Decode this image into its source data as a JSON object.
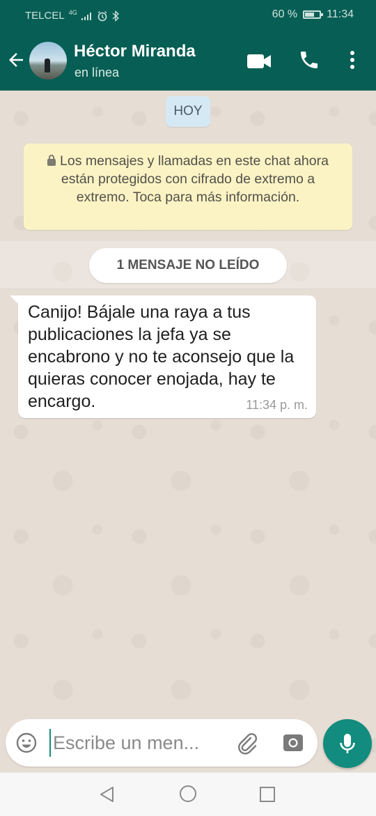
{
  "status_bar": {
    "carrier": "TELCEL",
    "network": "4G",
    "battery_percent": "60 %",
    "battery_level": 0.6,
    "time": "11:34"
  },
  "header": {
    "contact_name": "Héctor Miranda",
    "contact_status": "en línea"
  },
  "chat": {
    "date_chip": "HOY",
    "encryption_notice": "Los mensajes y llamadas en este chat ahora están protegidos con cifrado de extremo a extremo. Toca para más información.",
    "unread_label": "1 MENSAJE NO LEÍDO",
    "messages": [
      {
        "text": "Canijo! Bájale una raya a tus publicaciones la jefa ya se encabrono y no te aconsejo que la quieras conocer enojada, hay te encargo.",
        "time": "11:34 p. m."
      }
    ]
  },
  "composer": {
    "placeholder": "Escribe un men..."
  },
  "colors": {
    "header": "#075e54",
    "accent": "#128c7e",
    "chat_background": "#e6ddd4",
    "notice_background": "#fbf3c4",
    "date_chip_background": "#d5e9f4"
  },
  "icons": [
    "back-arrow-icon",
    "video-call-icon",
    "phone-icon",
    "more-vert-icon",
    "lock-icon",
    "emoji-icon",
    "attach-icon",
    "camera-icon",
    "mic-icon",
    "nav-back-icon",
    "nav-home-icon",
    "nav-recent-icon"
  ]
}
